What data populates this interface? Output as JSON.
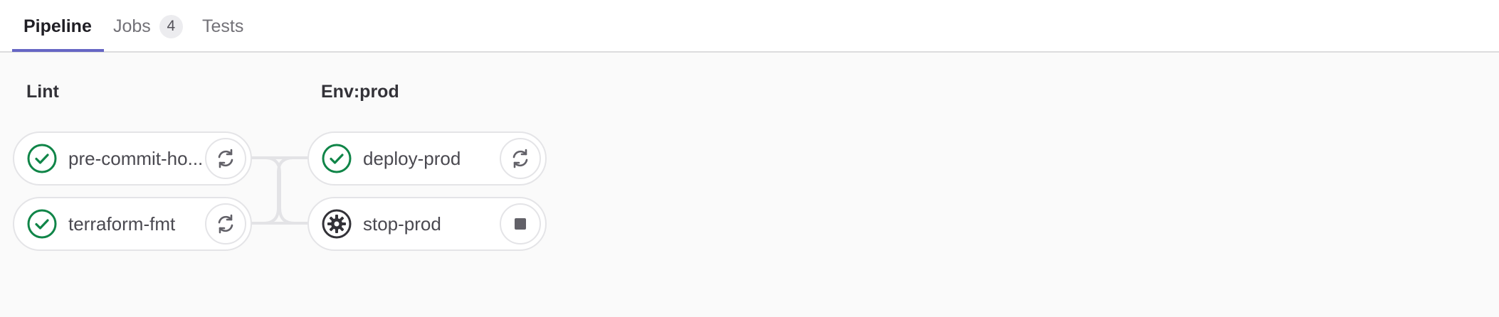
{
  "tabs": {
    "pipeline_label": "Pipeline",
    "jobs_label": "Jobs",
    "jobs_count": "4",
    "tests_label": "Tests"
  },
  "stages": [
    {
      "title": "Lint",
      "jobs": [
        {
          "name": "pre-commit-ho...",
          "status": "success",
          "status_icon": "check-circle-icon",
          "action": "retry",
          "action_icon": "retry-icon"
        },
        {
          "name": "terraform-fmt",
          "status": "success",
          "status_icon": "check-circle-icon",
          "action": "retry",
          "action_icon": "retry-icon"
        }
      ]
    },
    {
      "title": "Env:prod",
      "jobs": [
        {
          "name": "deploy-prod",
          "status": "success",
          "status_icon": "check-circle-icon",
          "action": "retry",
          "action_icon": "retry-icon"
        },
        {
          "name": "stop-prod",
          "status": "manual",
          "status_icon": "gear-icon",
          "action": "stop",
          "action_icon": "stop-icon"
        }
      ]
    }
  ],
  "colors": {
    "success": "#108548",
    "active_tab_underline": "#6666c4",
    "manual": "#333238"
  }
}
